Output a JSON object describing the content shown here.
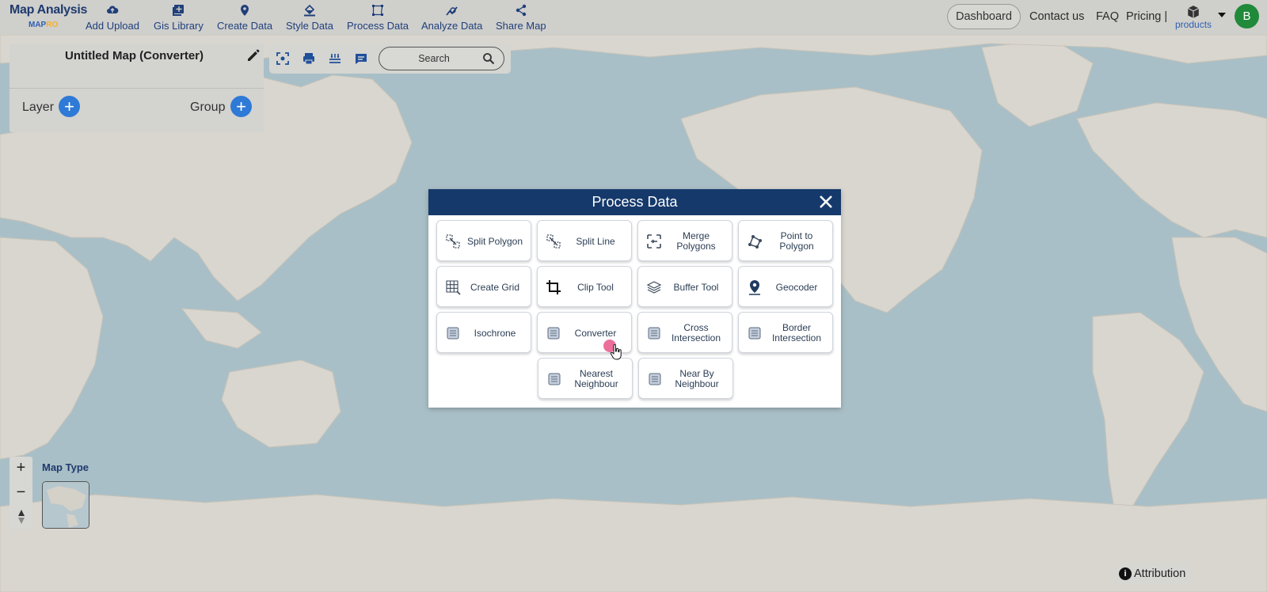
{
  "colors": {
    "brand": "#1e3a6e",
    "accent": "#2e7ad6",
    "dialog_header": "#15396b",
    "avatar": "#1f8a3a",
    "cursor_dot": "#e9568a"
  },
  "logo": {
    "line1": "Map Analysis",
    "line2a": "MAP",
    "line2b": "RO"
  },
  "nav": {
    "items": [
      {
        "label": "Add Upload",
        "icon": "cloud-upload-icon"
      },
      {
        "label": "Gis Library",
        "icon": "library-icon"
      },
      {
        "label": "Create Data",
        "icon": "location-pin-icon"
      },
      {
        "label": "Style Data",
        "icon": "paint-bucket-icon"
      },
      {
        "label": "Process Data",
        "icon": "process-nodes-icon"
      },
      {
        "label": "Analyze Data",
        "icon": "analyze-icon"
      },
      {
        "label": "Share Map",
        "icon": "share-icon"
      }
    ],
    "dashboard": "Dashboard",
    "contact": "Contact us",
    "faq": "FAQ",
    "pricing": "Pricing |",
    "products": "products",
    "avatar_initial": "B"
  },
  "layer_panel": {
    "map_title": "Untitled Map (Converter)",
    "layer_label": "Layer",
    "group_label": "Group"
  },
  "toolbar": {
    "search_placeholder": "Search"
  },
  "map_controls": {
    "zoom_in": "+",
    "zoom_out": "−",
    "map_type_label": "Map Type",
    "attribution": "Attribution"
  },
  "dialog": {
    "title": "Process Data",
    "tools": [
      {
        "label": "Split Polygon",
        "icon": "split-polygon-icon"
      },
      {
        "label": "Split Line",
        "icon": "split-line-icon"
      },
      {
        "label": "Merge Polygons",
        "icon": "merge-polygons-icon"
      },
      {
        "label": "Point to Polygon",
        "icon": "point-to-polygon-icon"
      },
      {
        "label": "Create Grid",
        "icon": "grid-icon"
      },
      {
        "label": "Clip Tool",
        "icon": "crop-icon"
      },
      {
        "label": "Buffer Tool",
        "icon": "layers-icon"
      },
      {
        "label": "Geocoder",
        "icon": "geocoder-pin-icon"
      },
      {
        "label": "Isochrone",
        "icon": "isochrone-icon"
      },
      {
        "label": "Converter",
        "icon": "converter-icon"
      },
      {
        "label": "Cross Intersection",
        "icon": "cross-intersection-icon"
      },
      {
        "label": "Border Intersection",
        "icon": "border-intersection-icon"
      },
      {
        "label": "Nearest Neighbour",
        "icon": "nearest-neighbour-icon"
      },
      {
        "label": "Near By Neighbour",
        "icon": "near-by-neighbour-icon"
      }
    ]
  }
}
